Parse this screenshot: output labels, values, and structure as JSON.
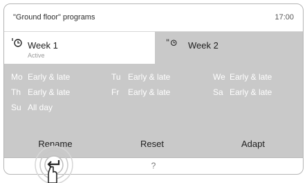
{
  "header": {
    "title": "\"Ground floor\" programs",
    "time": "17:00"
  },
  "tabs": [
    {
      "label": "Week 1",
      "sublabel": "Active",
      "icon": "clock-icon",
      "selected": true
    },
    {
      "label": "Week 2",
      "icon": "clock-icon",
      "selected": false
    }
  ],
  "schedule": [
    {
      "day": "Mo",
      "program": "Early & late"
    },
    {
      "day": "Tu",
      "program": "Early & late"
    },
    {
      "day": "We",
      "program": "Early & late"
    },
    {
      "day": "Th",
      "program": "Early & late"
    },
    {
      "day": "Fr",
      "program": "Early & late"
    },
    {
      "day": "Sa",
      "program": "Early & late"
    },
    {
      "day": "Su",
      "program": "All day"
    }
  ],
  "actions": {
    "rename": "Rename",
    "reset": "Reset",
    "adapt": "Adapt"
  },
  "footer": {
    "help": "?",
    "back_icon": "back-arrow-icon"
  },
  "colors": {
    "panel": "#c9c9c9",
    "active_tab": "#ffffff",
    "schedule_text": "#ffffff"
  }
}
